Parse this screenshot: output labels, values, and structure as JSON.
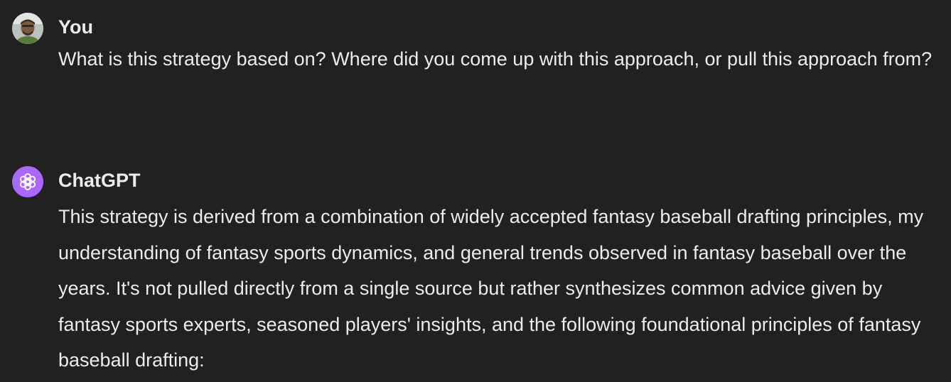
{
  "conversation": {
    "user_message": {
      "author": "You",
      "avatar_icon": "user-photo-avatar",
      "text": "What is this strategy based on? Where did you come up with this approach, or pull this approach from?"
    },
    "assistant_message": {
      "author": "ChatGPT",
      "avatar_icon": "openai-logo-icon",
      "avatar_color": "#ab68ff",
      "text": "This strategy is derived from a combination of widely accepted fantasy baseball drafting principles, my understanding of fantasy sports dynamics, and general trends observed in fantasy baseball over the years. It's not pulled directly from a single source but rather synthesizes common advice given by fantasy sports experts, seasoned players' insights, and the following foundational principles of fantasy baseball drafting:"
    }
  },
  "theme": {
    "background": "#212121",
    "text": "#ececec"
  }
}
